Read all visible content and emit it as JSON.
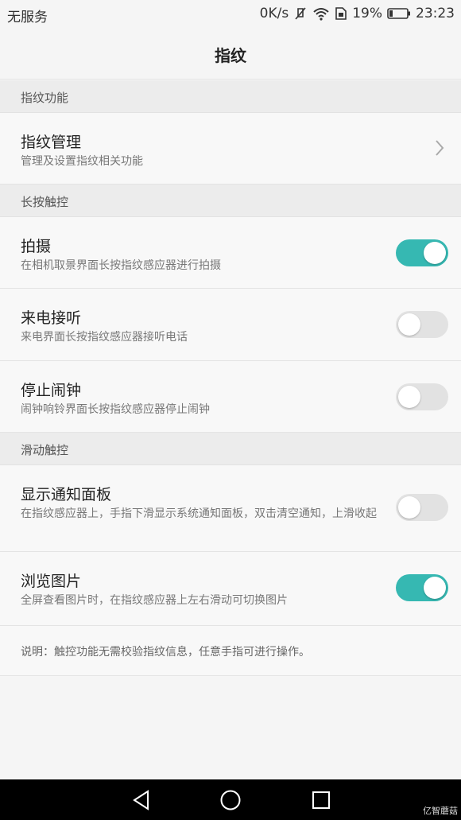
{
  "status_bar": {
    "carrier": "无服务",
    "net_speed": "0K/s",
    "battery": "19%",
    "time": "23:23"
  },
  "title_bar": {
    "title": "指纹"
  },
  "sections": {
    "fingerprint_functions": {
      "header": "指纹功能",
      "fingerprint_manage": {
        "title": "指纹管理",
        "subtitle": "管理及设置指纹相关功能"
      }
    },
    "long_press": {
      "header": "长按触控",
      "shoot": {
        "title": "拍摄",
        "subtitle": "在相机取景界面长按指纹感应器进行拍摄",
        "enabled": true
      },
      "answer_call": {
        "title": "来电接听",
        "subtitle": "来电界面长按指纹感应器接听电话",
        "enabled": false
      },
      "stop_alarm": {
        "title": "停止闹钟",
        "subtitle": "闹钟响铃界面长按指纹感应器停止闹钟",
        "enabled": false
      }
    },
    "swipe": {
      "header": "滑动触控",
      "notification_panel": {
        "title": "显示通知面板",
        "subtitle": "在指纹感应器上，手指下滑显示系统通知面板，双击清空通知，上滑收起",
        "enabled": false
      },
      "browse_pictures": {
        "title": "浏览图片",
        "subtitle": "全屏查看图片时，在指纹感应器上左右滑动可切换图片",
        "enabled": true
      }
    }
  },
  "note": "说明：触控功能无需校验指纹信息，任意手指可进行操作。",
  "watermark": "亿智蘑菇",
  "colors": {
    "accent": "#36b8b2",
    "toggle_off": "#e2e2e2",
    "nav_bar": "#000000"
  },
  "icons": [
    "mute-icon",
    "wifi-icon",
    "sim-icon",
    "battery-icon",
    "chevron-right-icon",
    "back-icon",
    "home-icon",
    "recents-icon"
  ]
}
